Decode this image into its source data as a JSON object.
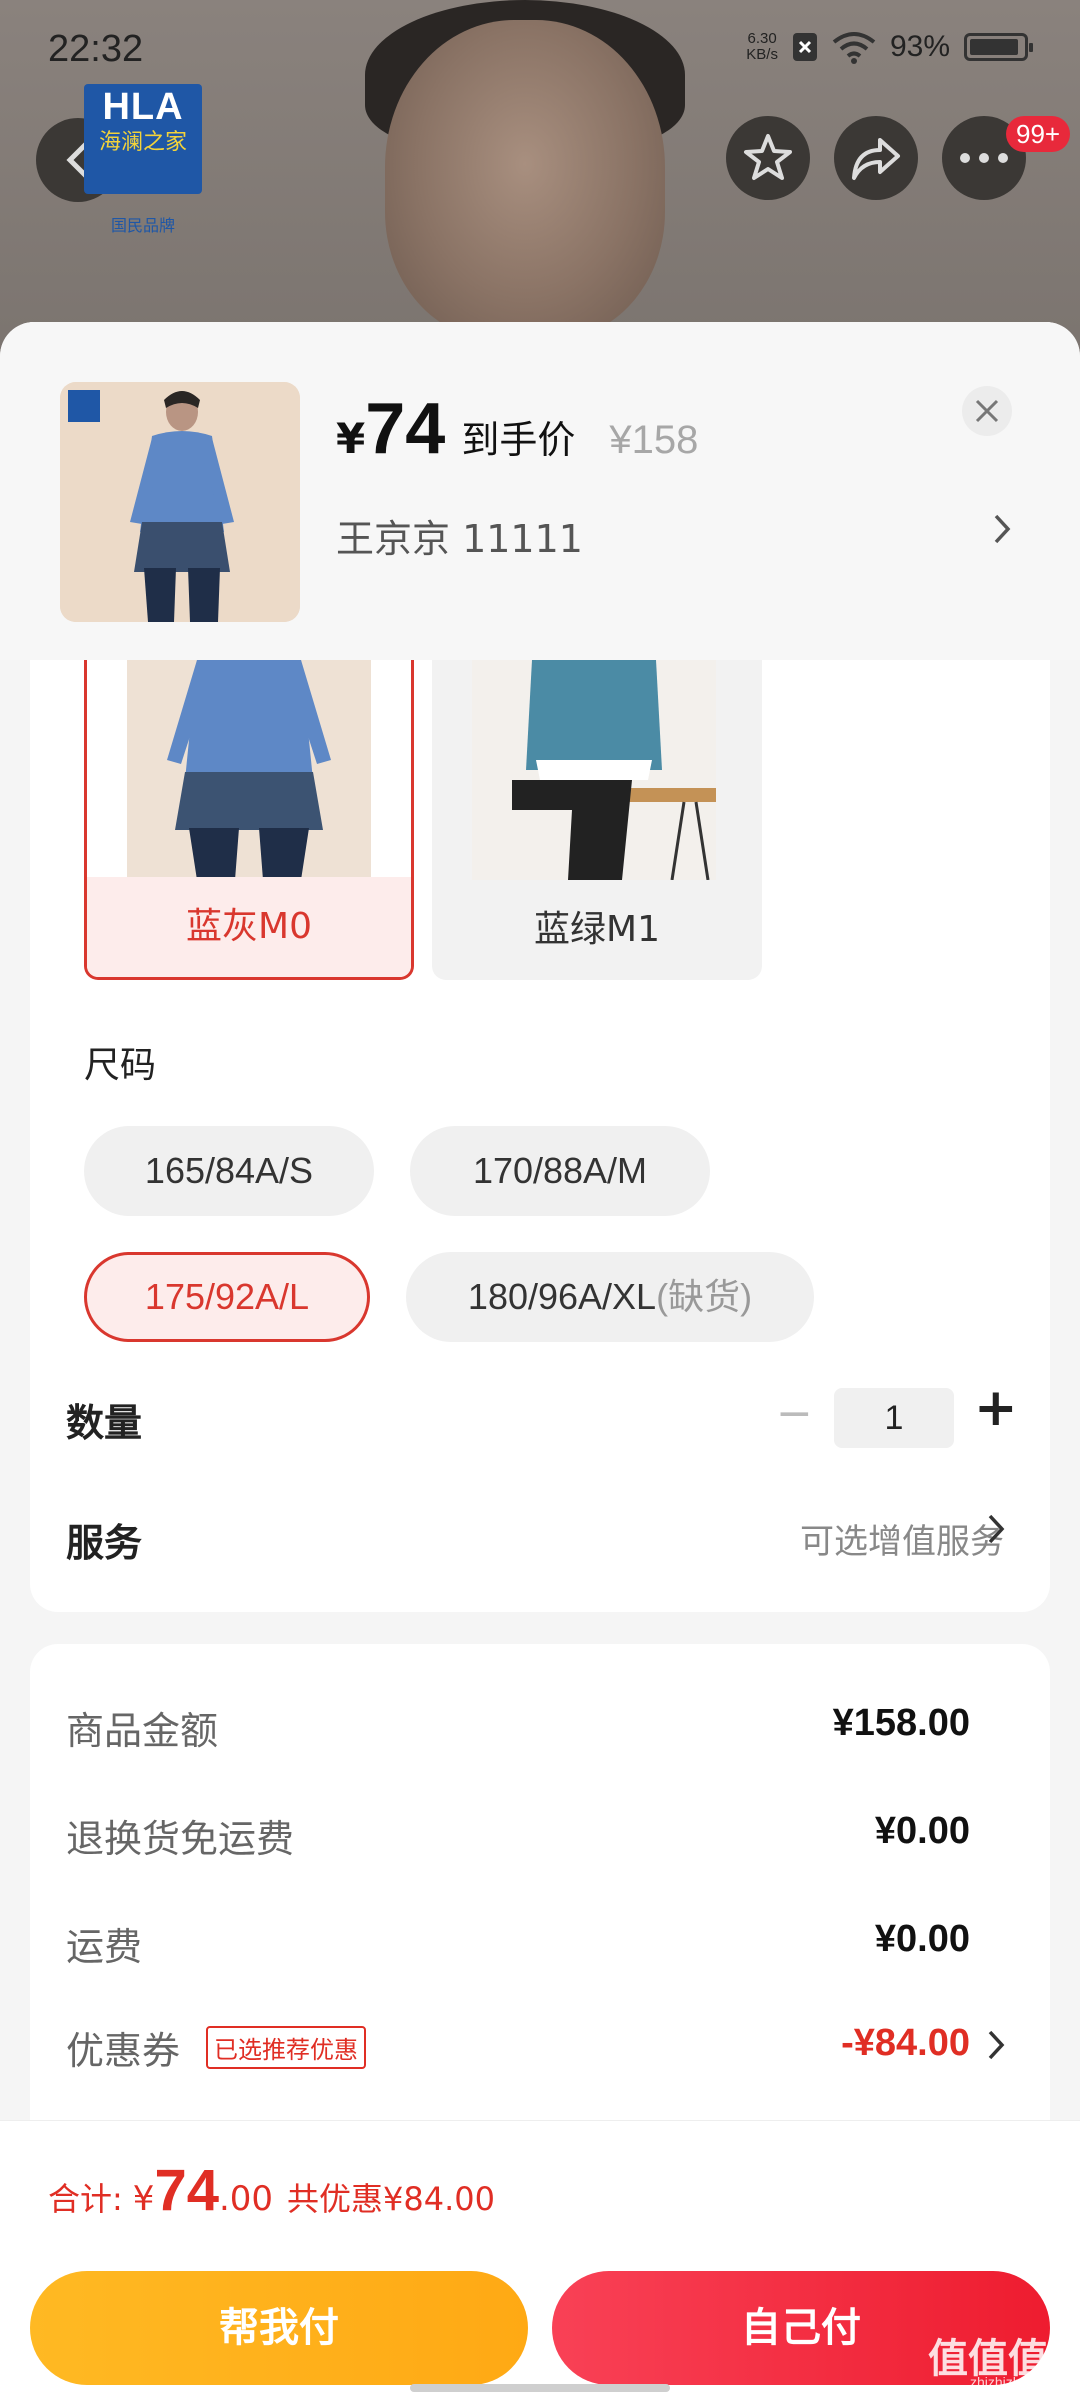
{
  "status_bar": {
    "time": "22:32",
    "net_speed_top": "6.30",
    "net_speed_bottom": "KB/s",
    "battery": "93%",
    "battery_level": 0.93
  },
  "header": {
    "brand_logo_top": "HLA",
    "brand_logo_mid": "海澜之家",
    "brand_logo_sub": "国民品牌",
    "more_badge": "99+"
  },
  "product": {
    "price_currency": "¥",
    "price": "74",
    "price_tag": "到手价",
    "original_price": "¥158",
    "address": "王京京  11111",
    "close_icon": "close-icon"
  },
  "colors": [
    {
      "label": "蓝灰M0",
      "selected": true
    },
    {
      "label": "蓝绿M1",
      "selected": false
    }
  ],
  "size": {
    "title": "尺码",
    "options": [
      {
        "label": "165/84A/S"
      },
      {
        "label": "170/88A/M"
      },
      {
        "label": "175/92A/L"
      },
      {
        "label": "180/96A/XL",
        "note": "(缺货)"
      }
    ]
  },
  "quantity": {
    "label": "数量",
    "value": "1",
    "minus": "−",
    "plus": "+"
  },
  "service": {
    "label": "服务",
    "value": "可选增值服务"
  },
  "summary": {
    "goods_label": "商品金额",
    "goods_value": "¥158.00",
    "return_label": "退换货免运费",
    "return_value": "¥0.00",
    "shipping_label": "运费",
    "shipping_value": "¥0.00",
    "coupon_label": "优惠券",
    "coupon_tag": "已选推荐优惠",
    "coupon_value": "-¥84.00"
  },
  "footer": {
    "total_label": "合计:",
    "total_yen": "¥",
    "total_int": "74",
    "total_dec": ".00",
    "total_saving": "共优惠¥84.00",
    "help_pay": "帮我付",
    "self_pay": "自己付"
  },
  "watermark": {
    "main": "值值值",
    "sub": "zhizhizhi.com"
  },
  "colors_theme": {
    "accent_red": "#e02e24",
    "button_yellow": "#ffb923",
    "button_red": "#f94156"
  }
}
